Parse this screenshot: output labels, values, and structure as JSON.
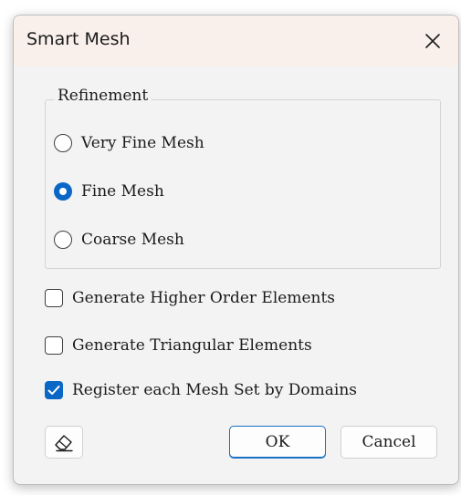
{
  "window": {
    "title": "Smart Mesh",
    "close_icon": "close-icon"
  },
  "refinement": {
    "label": "Refinement",
    "options": [
      {
        "label": "Very Fine Mesh",
        "selected": false
      },
      {
        "label": "Fine Mesh",
        "selected": true
      },
      {
        "label": "Coarse Mesh",
        "selected": false
      }
    ]
  },
  "checkboxes": [
    {
      "label": "Generate Higher Order Elements",
      "checked": false
    },
    {
      "label": "Generate Triangular Elements",
      "checked": false
    },
    {
      "label": "Register each Mesh Set by Domains",
      "checked": true
    }
  ],
  "buttons": {
    "eraser_icon": "eraser-icon",
    "ok_label": "OK",
    "cancel_label": "Cancel"
  },
  "colors": {
    "accent": "#0a67c6",
    "titlebar": "#f9f0eb",
    "dialog_bg": "#f3f3f3"
  }
}
